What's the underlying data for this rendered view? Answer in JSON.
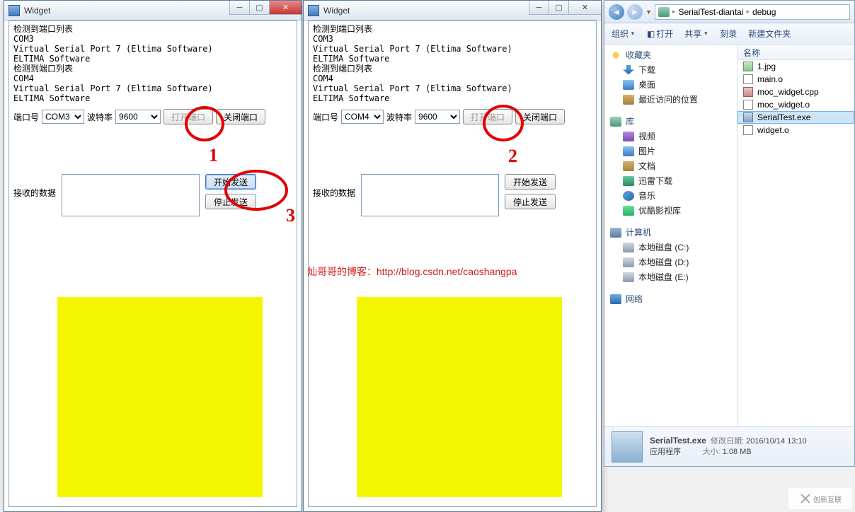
{
  "widget1": {
    "title": "Widget",
    "log": "检测到端口列表\nCOM3\nVirtual Serial Port 7 (Eltima Software)\nELTIMA Software\n检测到端口列表\nCOM4\nVirtual Serial Port 7 (Eltima Software)\nELTIMA Software",
    "port_label": "端口号",
    "port_value": "COM3",
    "baud_label": "波特率",
    "baud_value": "9600",
    "open_btn": "打开端口",
    "close_btn": "关闭端口",
    "recv_label": "接收的数据",
    "start_btn": "开始发送",
    "stop_btn": "停止发送"
  },
  "widget2": {
    "title": "Widget",
    "log": "检测到端口列表\nCOM3\nVirtual Serial Port 7 (Eltima Software)\nELTIMA Software\n检测到端口列表\nCOM4\nVirtual Serial Port 7 (Eltima Software)\nELTIMA Software",
    "port_label": "端口号",
    "port_value": "COM4",
    "baud_label": "波特率",
    "baud_value": "9600",
    "open_btn": "打开端口",
    "close_btn": "关闭端口",
    "recv_label": "接收的数据",
    "start_btn": "开始发送",
    "stop_btn": "停止发送"
  },
  "explorer": {
    "breadcrumb": [
      "SerialTest-diantai",
      "debug"
    ],
    "toolbar": {
      "org": "组织",
      "open": "打开",
      "share": "共享",
      "burn": "刻录",
      "new": "新建文件夹"
    },
    "tree": {
      "fav": {
        "head": "收藏夹",
        "items": [
          "下载",
          "桌面",
          "最近访问的位置"
        ]
      },
      "lib": {
        "head": "库",
        "items": [
          "视频",
          "图片",
          "文档",
          "迅雷下载",
          "音乐",
          "优酷影视库"
        ]
      },
      "pc": {
        "head": "计算机",
        "items": [
          "本地磁盘 (C:)",
          "本地磁盘 (D:)",
          "本地磁盘 (E:)"
        ]
      },
      "net": {
        "head": "网络"
      }
    },
    "col_name": "名称",
    "files": [
      "1.jpg",
      "main.o",
      "moc_widget.cpp",
      "moc_widget.o",
      "SerialTest.exe",
      "widget.o"
    ],
    "selected": "SerialTest.exe",
    "details": {
      "name": "SerialTest.exe",
      "type": "应用程序",
      "date_label": "修改日期:",
      "date": "2016/10/14 13:10",
      "size_label": "大小:",
      "size": "1.08 MB"
    }
  },
  "blog_text": "灿哥哥的博客：http://blog.csdn.net/caoshangpa",
  "annotations": {
    "n1": "1",
    "n2": "2",
    "n3": "3"
  },
  "watermark": "创新互联"
}
